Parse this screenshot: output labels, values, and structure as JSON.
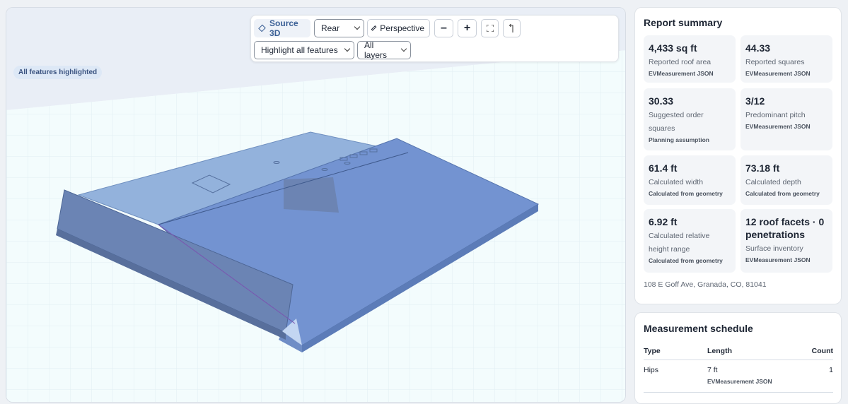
{
  "viewer": {
    "source_label": "Source 3D",
    "view_select": "Rear",
    "projection_label": "Perspective",
    "zoom_out_label": "–",
    "zoom_in_label": "+",
    "highlight_select": "Highlight all features",
    "layers_select": "All layers",
    "highlight_badge": "All features highlighted"
  },
  "summary": {
    "title": "Report summary",
    "stats": [
      {
        "value": "4,433 sq ft",
        "label": "Reported roof area",
        "source": "EVMeasurement JSON"
      },
      {
        "value": "44.33",
        "label": "Reported squares",
        "source": "EVMeasurement JSON"
      },
      {
        "value": "30.33",
        "label": "Suggested order squares",
        "source": "Planning assumption"
      },
      {
        "value": "3/12",
        "label": "Predominant pitch",
        "source": "EVMeasurement JSON"
      },
      {
        "value": "61.4 ft",
        "label": "Calculated width",
        "source": "Calculated from geometry"
      },
      {
        "value": "73.18 ft",
        "label": "Calculated depth",
        "source": "Calculated from geometry"
      },
      {
        "value": "6.92 ft",
        "label": "Calculated relative height range",
        "source": "Calculated from geometry"
      },
      {
        "value": "12 roof facets · 0 penetrations",
        "label": "Surface inventory",
        "source": "EVMeasurement JSON"
      }
    ],
    "address": "108 E Goff Ave, Granada, CO, 81041"
  },
  "schedule": {
    "title": "Measurement schedule",
    "columns": [
      "Type",
      "Length",
      "Count"
    ],
    "rows": [
      {
        "type": "Hips",
        "length": "7 ft",
        "source": "EVMeasurement JSON",
        "count": "1"
      }
    ]
  }
}
